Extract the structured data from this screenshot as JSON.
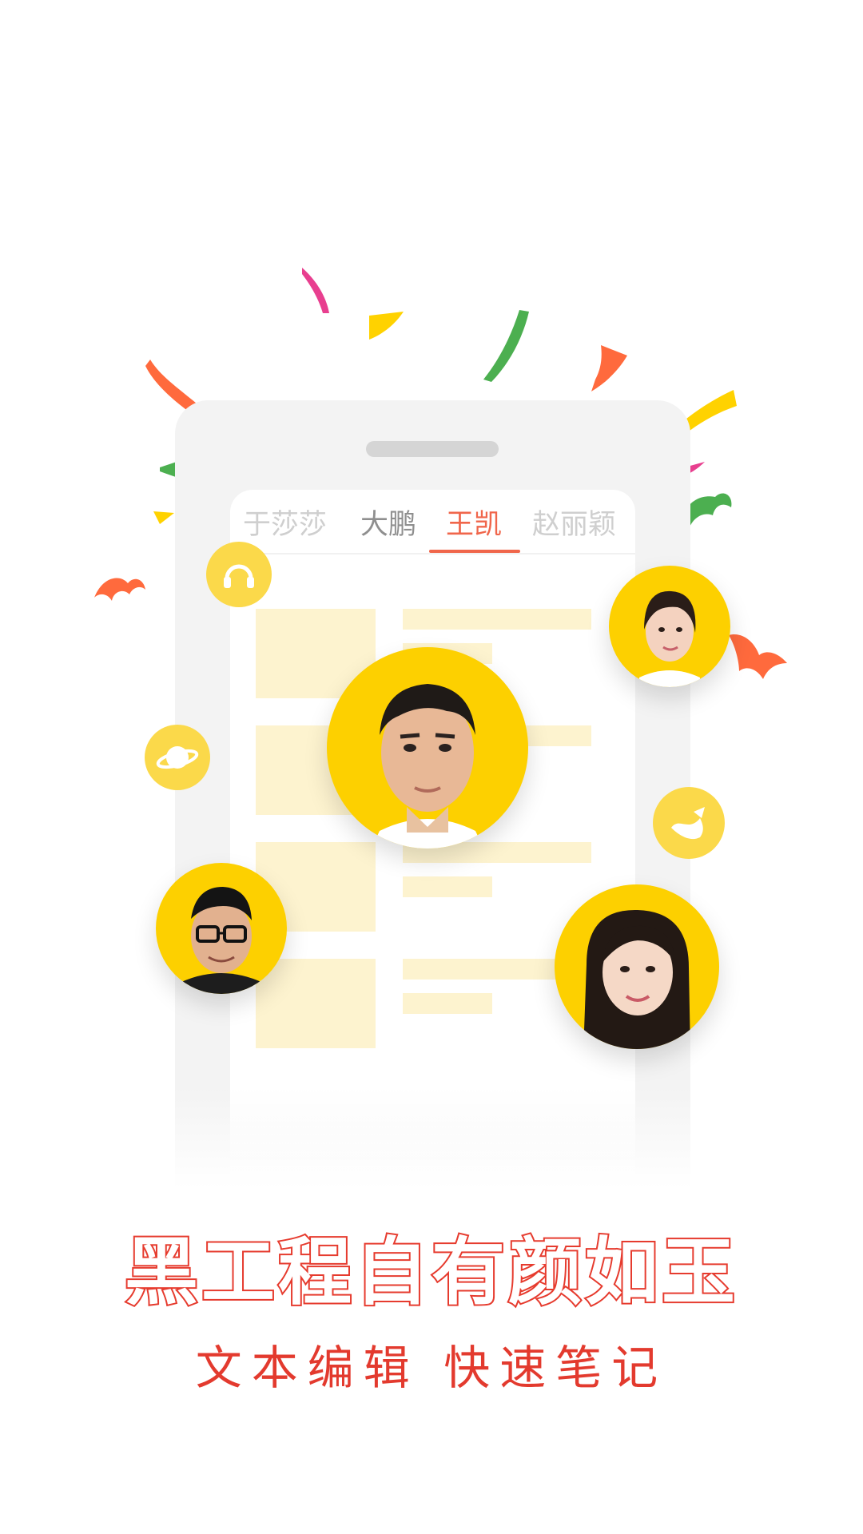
{
  "tabs": [
    {
      "label": "于莎莎",
      "state": "faded"
    },
    {
      "label": "大鹏",
      "state": "normal"
    },
    {
      "label": "王凯",
      "state": "active"
    },
    {
      "label": "赵丽颖",
      "state": "faded"
    }
  ],
  "headline": "黑工程自有颜如玉",
  "subline": "文本编辑 快速笔记",
  "colors": {
    "accent": "#f0664b",
    "headline_stroke": "#e63b2e",
    "avatar_bg": "#fdd000",
    "placeholder": "#fdf3cf"
  },
  "icons": [
    "headphones-icon",
    "planet-icon",
    "wave-flag-icon"
  ]
}
